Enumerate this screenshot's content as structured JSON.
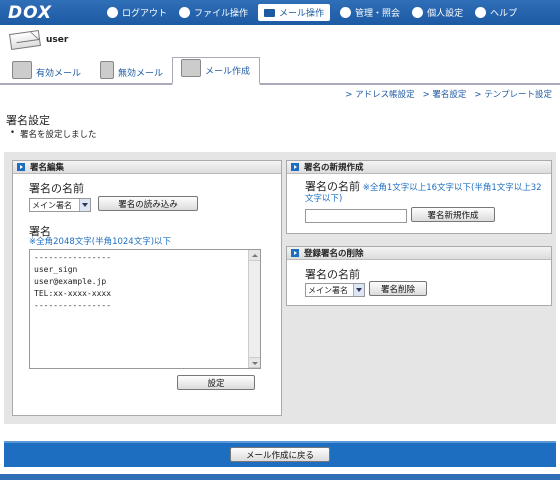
{
  "app": {
    "logo": "DOX"
  },
  "nav": {
    "items": [
      {
        "label": "ログアウト",
        "icon": "power-icon"
      },
      {
        "label": "ファイル操作",
        "icon": "gear-icon"
      },
      {
        "label": "メール操作",
        "icon": "mail-icon",
        "active": true
      },
      {
        "label": "管理・照会",
        "icon": "admin-icon"
      },
      {
        "label": "個人設定",
        "icon": "user-icon"
      },
      {
        "label": "ヘルプ",
        "icon": "help-icon"
      }
    ]
  },
  "user": {
    "name": "user"
  },
  "tabs": [
    {
      "label": "有効メール",
      "icon": "mail-open-icon"
    },
    {
      "label": "無効メール",
      "icon": "trash-icon"
    },
    {
      "label": "メール作成",
      "icon": "compose-icon",
      "active": true
    }
  ],
  "sublinks": [
    "アドレス帳設定",
    "署名設定",
    "テンプレート設定"
  ],
  "sublink_separator": ">",
  "page": {
    "title": "署名設定",
    "message": "署名を設定しました"
  },
  "edit_panel": {
    "title": "署名編集",
    "name_label": "署名の名前",
    "select_value": "メイン署名",
    "load_button": "署名の読み込み",
    "body_label": "署名",
    "body_note": "※全角2048文字(半角1024文字)以下",
    "body_lines": [
      "----------------",
      "user_sign",
      "user@example.jp",
      "TEL:xx-xxxx-xxxx",
      "----------------"
    ],
    "submit_button": "設定"
  },
  "new_panel": {
    "title": "署名の新規作成",
    "name_label": "署名の名前",
    "note": "※全角1文字以上16文字以下(半角1文字以上32文字以下)",
    "input_value": "",
    "create_button": "署名新規作成"
  },
  "delete_panel": {
    "title": "登録署名の削除",
    "name_label": "署名の名前",
    "select_value": "メイン署名",
    "delete_button": "署名削除"
  },
  "footer": {
    "back_button": "メール作成に戻る"
  },
  "colors": {
    "nav_blue": "#1d5aa3",
    "accent_blue": "#1d6ec0",
    "panel_bg": "#e5e5e5"
  }
}
